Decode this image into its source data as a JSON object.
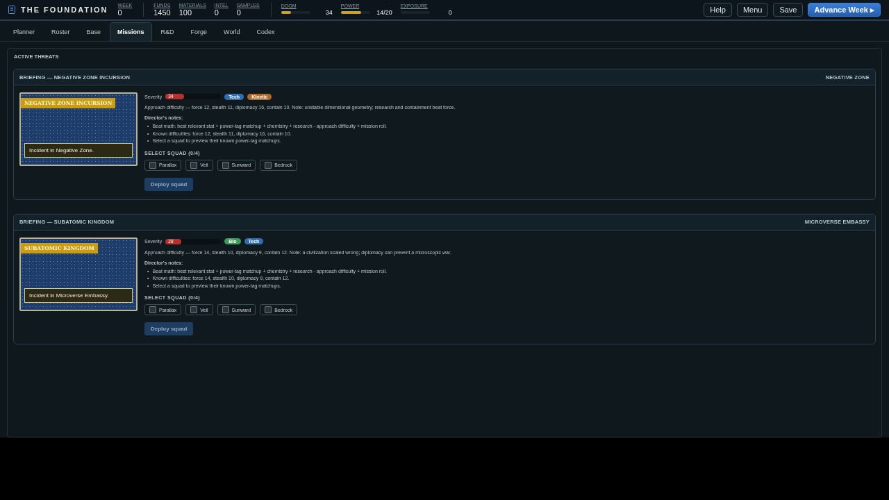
{
  "header": {
    "brand": "THE FOUNDATION",
    "stats": [
      {
        "label": "WEEK",
        "value": "0"
      },
      {
        "label": "FUNDS",
        "value": "1450"
      },
      {
        "label": "MATERIALS",
        "value": "100"
      },
      {
        "label": "INTEL",
        "value": "0"
      },
      {
        "label": "SAMPLES",
        "value": "0"
      }
    ],
    "meters": [
      {
        "label": "DOOM",
        "level": 0.34,
        "reading": "34"
      },
      {
        "label": "POWER",
        "level": 0.7,
        "reading": "14/20"
      },
      {
        "label": "EXPOSURE",
        "reading": "0"
      }
    ],
    "buttons": [
      {
        "label": "Help",
        "kind": "plain"
      },
      {
        "label": "Menu",
        "kind": "plain"
      },
      {
        "label": "Save",
        "kind": "plain"
      },
      {
        "label": "Advance Week ▸",
        "kind": "primary"
      }
    ]
  },
  "tabs": [
    {
      "label": "Planner",
      "selected": false
    },
    {
      "label": "Roster",
      "selected": false
    },
    {
      "label": "Base",
      "selected": false
    },
    {
      "label": "Missions",
      "selected": true
    },
    {
      "label": "R&D",
      "selected": false
    },
    {
      "label": "Forge",
      "selected": false
    },
    {
      "label": "World",
      "selected": false
    },
    {
      "label": "Codex",
      "selected": false
    }
  ],
  "panel": {
    "title": "ACTIVE THREATS"
  },
  "briefings": [
    {
      "title": "BRIEFING — NEGATIVE ZONE INCURSION",
      "location": "NEGATIVE ZONE",
      "banner": "NEGATIVE ZONE INCURSION",
      "caption": "Incident in Negative Zone.",
      "severity": {
        "label": "Severity",
        "level": 0.34,
        "reading": "34"
      },
      "tags": [
        {
          "label": "Tech",
          "color": "#2f6db0"
        },
        {
          "label": "Kinetic",
          "color": "#b0672a"
        }
      ],
      "approach": "Approach difficulty — force 12, stealth 11, diplomacy 16, contain 10. Note: unstable dimensional geometry; research and containment beat force.",
      "notes_title": "Director's notes:",
      "bullet": "•",
      "notes": [
        "Beat math: best relevant stat + power-tag matchup + chemistry + research - approach difficulty + mission roll.",
        "Known difficulties: force 12, stealth 11, diplomacy 16, contain 10.",
        "Select a squad to preview their known power-tag matchups."
      ],
      "squad_title": "SELECT SQUAD (0/4)",
      "squads": [
        {
          "label": "Parallax",
          "checked": false
        },
        {
          "label": "Veil",
          "checked": false
        },
        {
          "label": "Sunward",
          "checked": false
        },
        {
          "label": "Bedrock",
          "checked": false
        }
      ],
      "deploy": {
        "label": "Deploy squad",
        "disabled": true
      }
    },
    {
      "title": "BRIEFING — SUBATOMIC KINGDOM",
      "location": "MICROVERSE EMBASSY",
      "banner": "SUBATOMIC KINGDOM",
      "caption": "Incident in Microverse Embassy.",
      "severity": {
        "label": "Severity",
        "level": 0.28,
        "reading": "28"
      },
      "tags": [
        {
          "label": "Bio",
          "color": "#3f9a5a"
        },
        {
          "label": "Tech",
          "color": "#2f6db0"
        }
      ],
      "approach": "Approach difficulty — force 14, stealth 10, diplomacy 9, contain 12. Note: a civilization scaled wrong; diplomacy can prevent a microscopic war.",
      "notes_title": "Director's notes:",
      "bullet": "•",
      "notes": [
        "Beat math: best relevant stat + power-tag matchup + chemistry + research - approach difficulty + mission roll.",
        "Known difficulties: force 14, stealth 10, diplomacy 9, contain 12.",
        "Select a squad to preview their known power-tag matchups."
      ],
      "squad_title": "SELECT SQUAD (0/4)",
      "squads": [
        {
          "label": "Parallax",
          "checked": false
        },
        {
          "label": "Veil",
          "checked": false
        },
        {
          "label": "Sunward",
          "checked": false
        },
        {
          "label": "Bedrock",
          "checked": false
        }
      ],
      "deploy": {
        "label": "Deploy squad",
        "disabled": true
      }
    }
  ]
}
